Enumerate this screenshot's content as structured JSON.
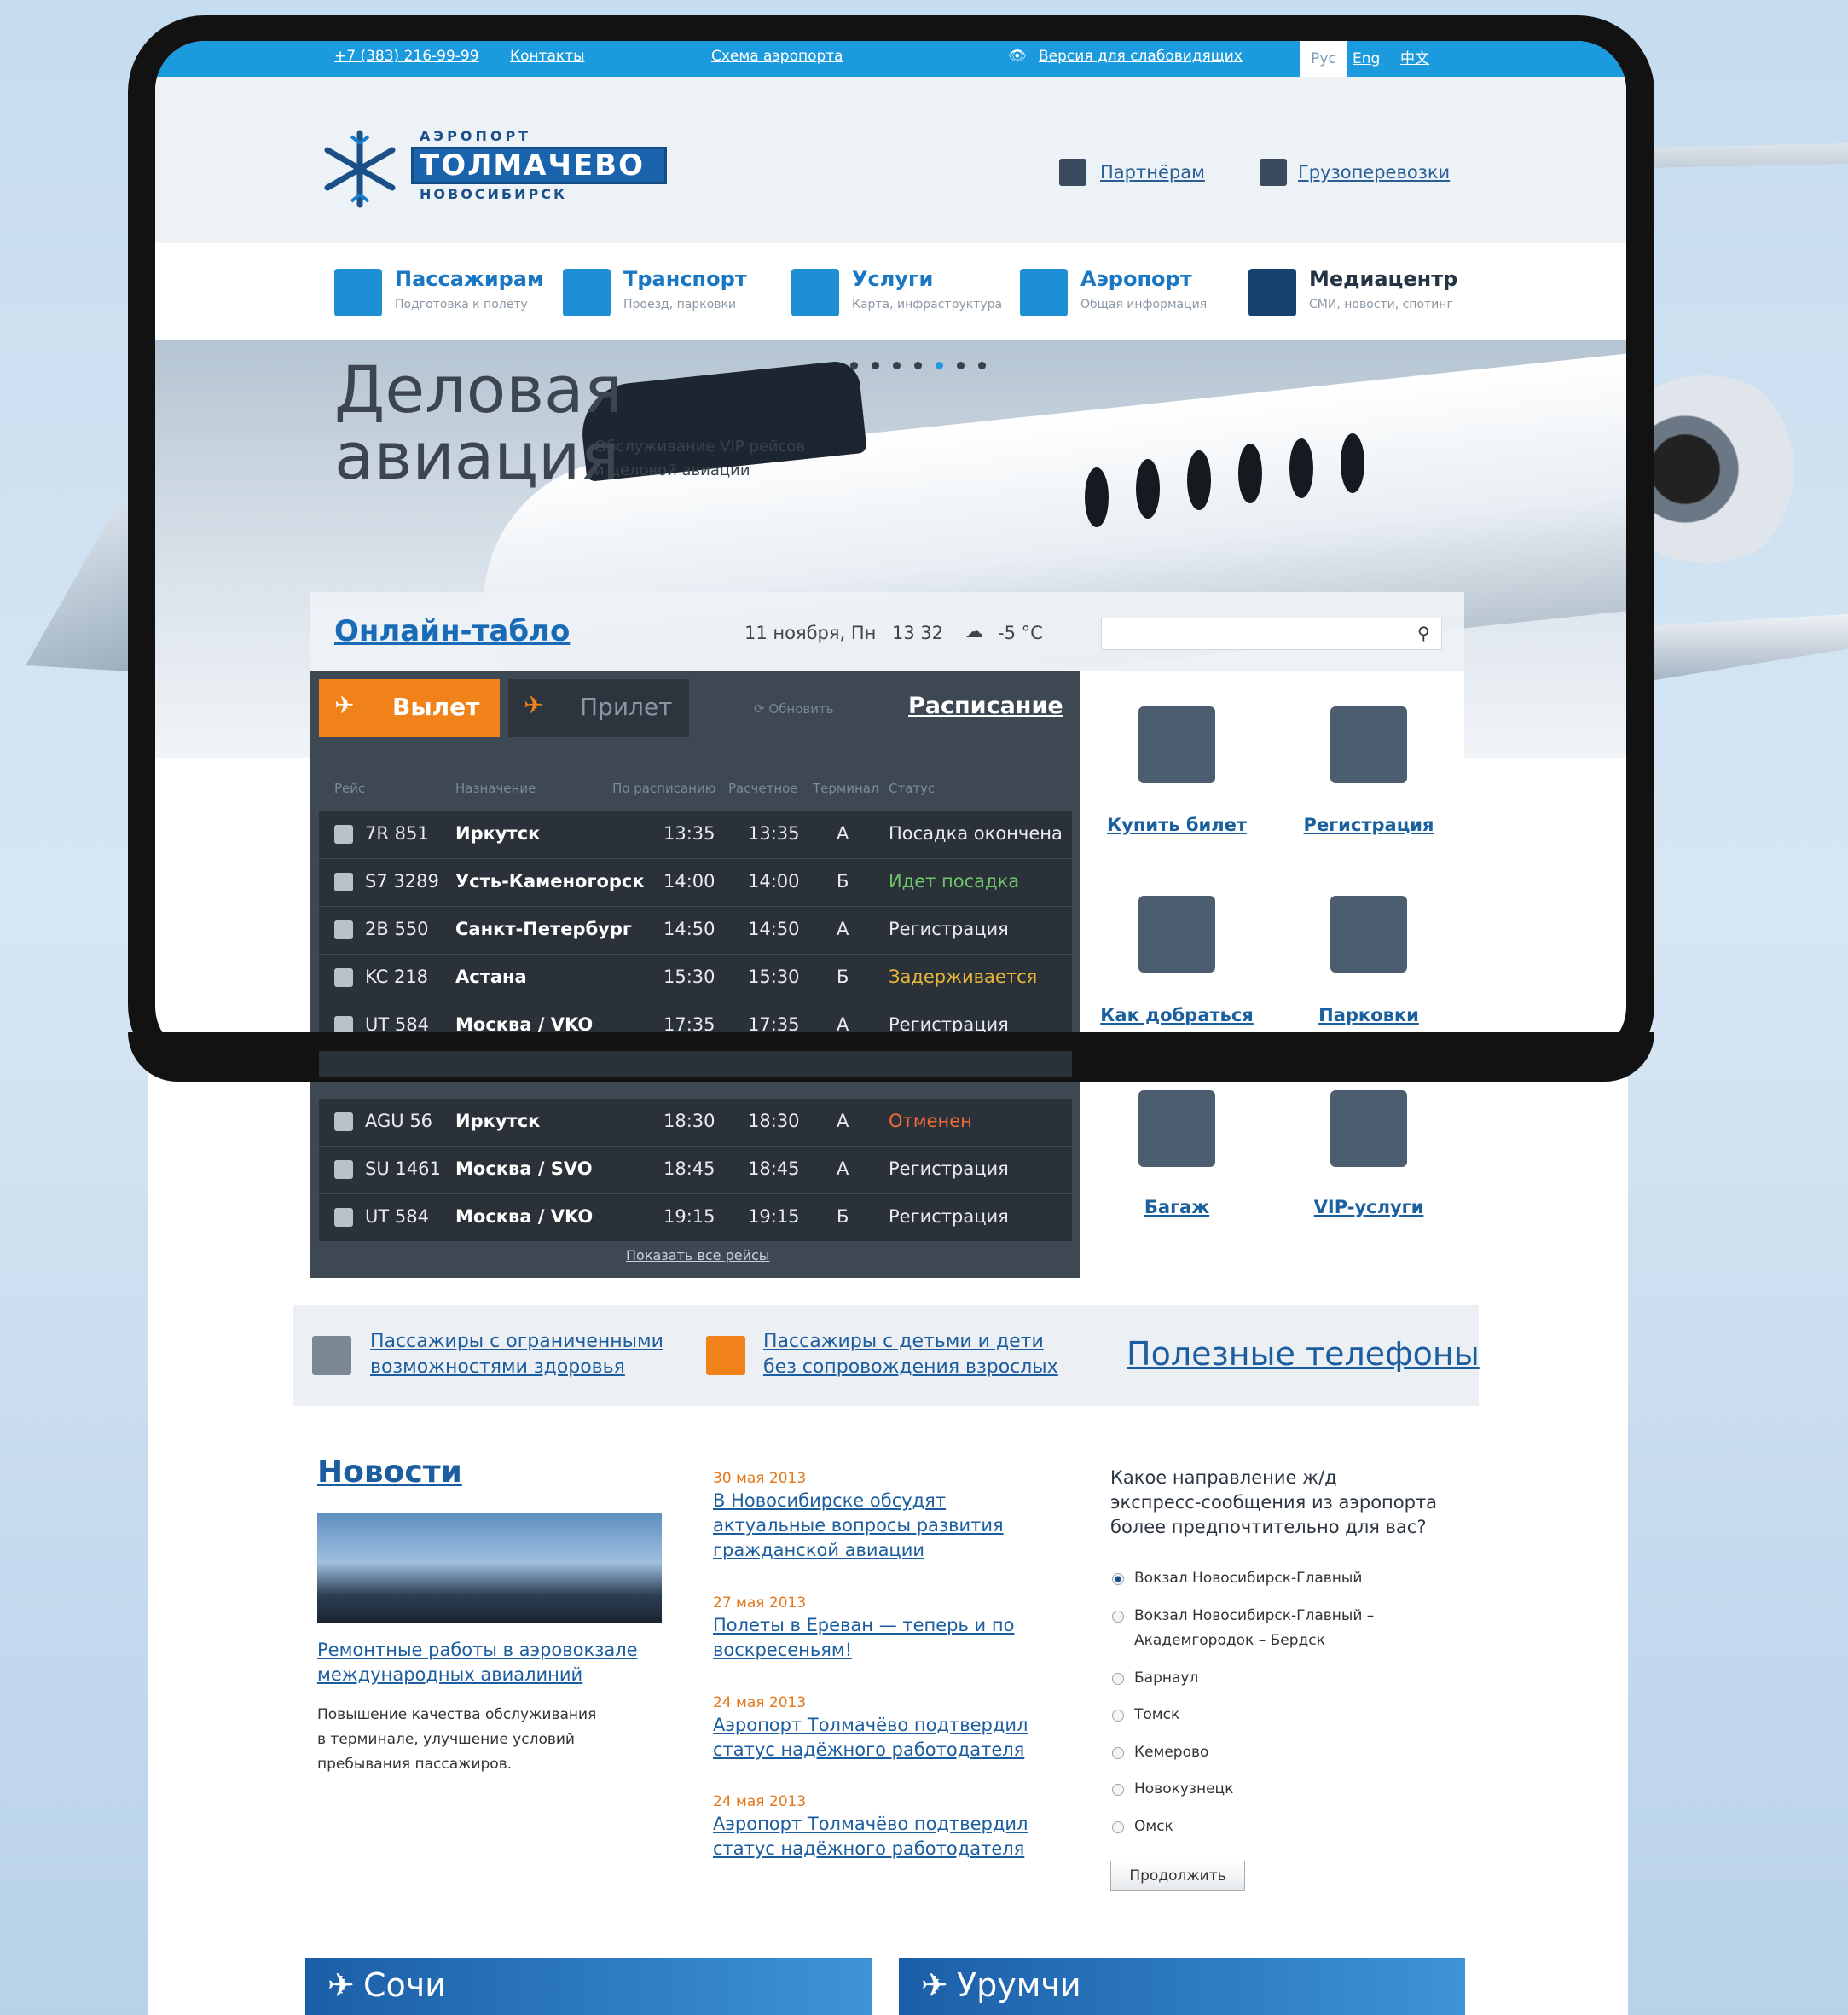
{
  "topbar": {
    "phone": "+7 (383) 216-99-99",
    "contacts": "Контакты",
    "airport_map": "Схема аэропорта",
    "accessibility": "Версия для слабовидящих",
    "languages": [
      {
        "label": "Рус",
        "active": true
      },
      {
        "label": "Eng",
        "active": false
      },
      {
        "label": "中文",
        "active": false
      }
    ]
  },
  "logo": {
    "top": "АЭРОПОРТ",
    "main": "ТОЛМАЧЕВО",
    "bottom": "НОВОСИБИРСК"
  },
  "header_links": {
    "partners": "Партнёрам",
    "cargo": "Грузоперевозки"
  },
  "nav": [
    {
      "title": "Пассажирам",
      "sub": "Подготовка к полёту"
    },
    {
      "title": "Транспорт",
      "sub": "Проезд, парковки"
    },
    {
      "title": "Услуги",
      "sub": "Карта, инфраструктура"
    },
    {
      "title": "Аэропорт",
      "sub": "Общая информация"
    },
    {
      "title": "Медиацентр",
      "sub": "СМИ, новости, спотинг"
    }
  ],
  "hero": {
    "title": "Деловая\nавиация",
    "subtitle": "Обслуживание VIP рейсов\nи деловой авиации",
    "slides_total": 7,
    "slide_active": 5
  },
  "board": {
    "title": "Онлайн-табло",
    "date": "11 ноября, Пн",
    "time": "13 32",
    "weather": "-5 °C",
    "search_placeholder": "",
    "tab_departure": "Вылет",
    "tab_arrival": "Прилет",
    "refresh": "Обновить",
    "schedule": "Расписание",
    "columns": [
      "Рейс",
      "Назначение",
      "По расписанию",
      "Расчетное",
      "Терминал",
      "Статус"
    ],
    "rows": [
      {
        "flight": "7R 851",
        "dest": "Иркутск",
        "sched": "13:35",
        "est": "13:35",
        "term": "А",
        "status": "Посадка окончена",
        "status_color": "#e8ecef"
      },
      {
        "flight": "S7 3289",
        "dest": "Усть-Каменогорск",
        "sched": "14:00",
        "est": "14:00",
        "term": "Б",
        "status": "Идет посадка",
        "status_color": "#6dc36a"
      },
      {
        "flight": "2B 550",
        "dest": "Санкт-Петербург",
        "sched": "14:50",
        "est": "14:50",
        "term": "А",
        "status": "Регистрация",
        "status_color": "#e8ecef"
      },
      {
        "flight": "KC 218",
        "dest": "Астана",
        "sched": "15:30",
        "est": "15:30",
        "term": "Б",
        "status": "Задерживается",
        "status_color": "#e8b63a"
      },
      {
        "flight": "UT 584",
        "dest": "Москва / VKO",
        "sched": "17:35",
        "est": "17:35",
        "term": "А",
        "status": "Регистрация",
        "status_color": "#e8ecef"
      },
      {
        "flight": "AGU 56",
        "dest": "Иркутск",
        "sched": "18:30",
        "est": "18:30",
        "term": "А",
        "status": "Отменен",
        "status_color": "#f06a3a"
      },
      {
        "flight": "SU 1461",
        "dest": "Москва / SVO",
        "sched": "18:45",
        "est": "18:45",
        "term": "А",
        "status": "Регистрация",
        "status_color": "#e8ecef"
      },
      {
        "flight": "UT 584",
        "dest": "Москва / VKO",
        "sched": "19:15",
        "est": "19:15",
        "term": "Б",
        "status": "Регистрация",
        "status_color": "#e8ecef"
      }
    ],
    "show_all": "Показать все рейсы"
  },
  "services": [
    {
      "label": "Купить билет",
      "icon": "passport-icon"
    },
    {
      "label": "Регистрация",
      "icon": "checkin-monitor-icon"
    },
    {
      "label": "Как добраться",
      "icon": "map-pin-icon"
    },
    {
      "label": "Парковки",
      "icon": "parking-icon"
    },
    {
      "label": "Багаж",
      "icon": "luggage-icon"
    },
    {
      "label": "VIP-услуги",
      "icon": "vip-seat-icon"
    }
  ],
  "useful": {
    "disabled": "Пассажиры с ограниченными\nвозможностями здоровья",
    "children": "Пассажиры с детьми и дети\nбез сопровождения взрослых",
    "phones": "Полезные телефоны"
  },
  "news": {
    "title": "Новости",
    "main_link": "Ремонтные работы в аэровокзале\nмеждународных авиалиний",
    "main_text": "Повышение качества обслуживания\nв терминале, улучшение условий\nпребывания пассажиров.",
    "items": [
      {
        "date": "30 мая 2013",
        "text": "В Новосибирске обсудят\nактуальные вопросы развития\nгражданской авиации"
      },
      {
        "date": "27 мая 2013",
        "text": "Полеты в Ереван — теперь и по\nвоскресеньям!"
      },
      {
        "date": "24 мая 2013",
        "text": "Аэропорт Толмачёво подтвердил\nстатус надёжного работодателя"
      },
      {
        "date": "24 мая 2013",
        "text": "Аэропорт Толмачёво подтвердил\nстатус надёжного работодателя"
      }
    ]
  },
  "poll": {
    "question": "Какое направление ж/д\nэкспресс-сообщения из аэропорта\nболее предпочтительно для вас?",
    "options": [
      {
        "label": "Вокзал Новосибирск-Главный",
        "selected": true
      },
      {
        "label": "Вокзал Новосибирск-Главный –\nАкадемгородок – Бердск",
        "selected": false
      },
      {
        "label": "Барнаул",
        "selected": false
      },
      {
        "label": "Томск",
        "selected": false
      },
      {
        "label": "Кемерово",
        "selected": false
      },
      {
        "label": "Новокузнецк",
        "selected": false
      },
      {
        "label": "Омск",
        "selected": false
      }
    ],
    "submit": "Продолжить"
  },
  "promos": [
    {
      "title": "Сочи"
    },
    {
      "title": "Урумчи"
    }
  ]
}
